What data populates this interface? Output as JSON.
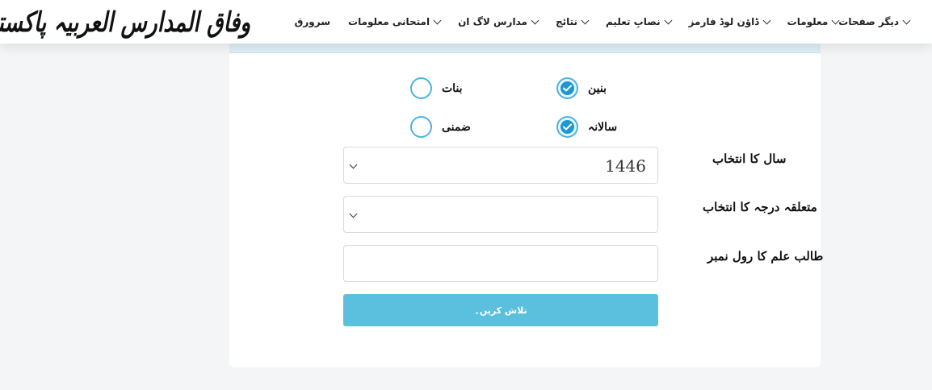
{
  "header": {
    "logo_text": "وفاق المدارس العربیہ پاکستان",
    "nav": [
      {
        "label": "سرورق",
        "has_dropdown": false
      },
      {
        "label": "امتحانی معلومات",
        "has_dropdown": true
      },
      {
        "label": "مدارس لاگ ان",
        "has_dropdown": true
      },
      {
        "label": "نتائج",
        "has_dropdown": true
      },
      {
        "label": "نصابِ تعلیم",
        "has_dropdown": true
      },
      {
        "label": "ڈاؤن لوڈ فارمز",
        "has_dropdown": true
      },
      {
        "label": "معلومات",
        "has_dropdown": true
      },
      {
        "label": "دیگر صفحات",
        "has_dropdown": true
      }
    ]
  },
  "form": {
    "gender_options": [
      {
        "label": "بنین",
        "checked": true
      },
      {
        "label": "بنات",
        "checked": false
      }
    ],
    "exam_type_options": [
      {
        "label": "سالانہ",
        "checked": true
      },
      {
        "label": "ضمنی",
        "checked": false
      }
    ],
    "year_label": "سال کا انتخاب",
    "year_value": "1446",
    "grade_label": "متعلقہ درجہ کا انتخاب",
    "grade_value": "",
    "roll_label": "طالب علم کا رول نمبر",
    "roll_value": "",
    "search_button": "تلاش کریں۔"
  },
  "colors": {
    "accent": "#1c98d2",
    "radio_border": "#4db2e0",
    "button": "#5bc0de",
    "page_bg": "#f3f5f7",
    "card_topbar": "#ddeef6"
  }
}
